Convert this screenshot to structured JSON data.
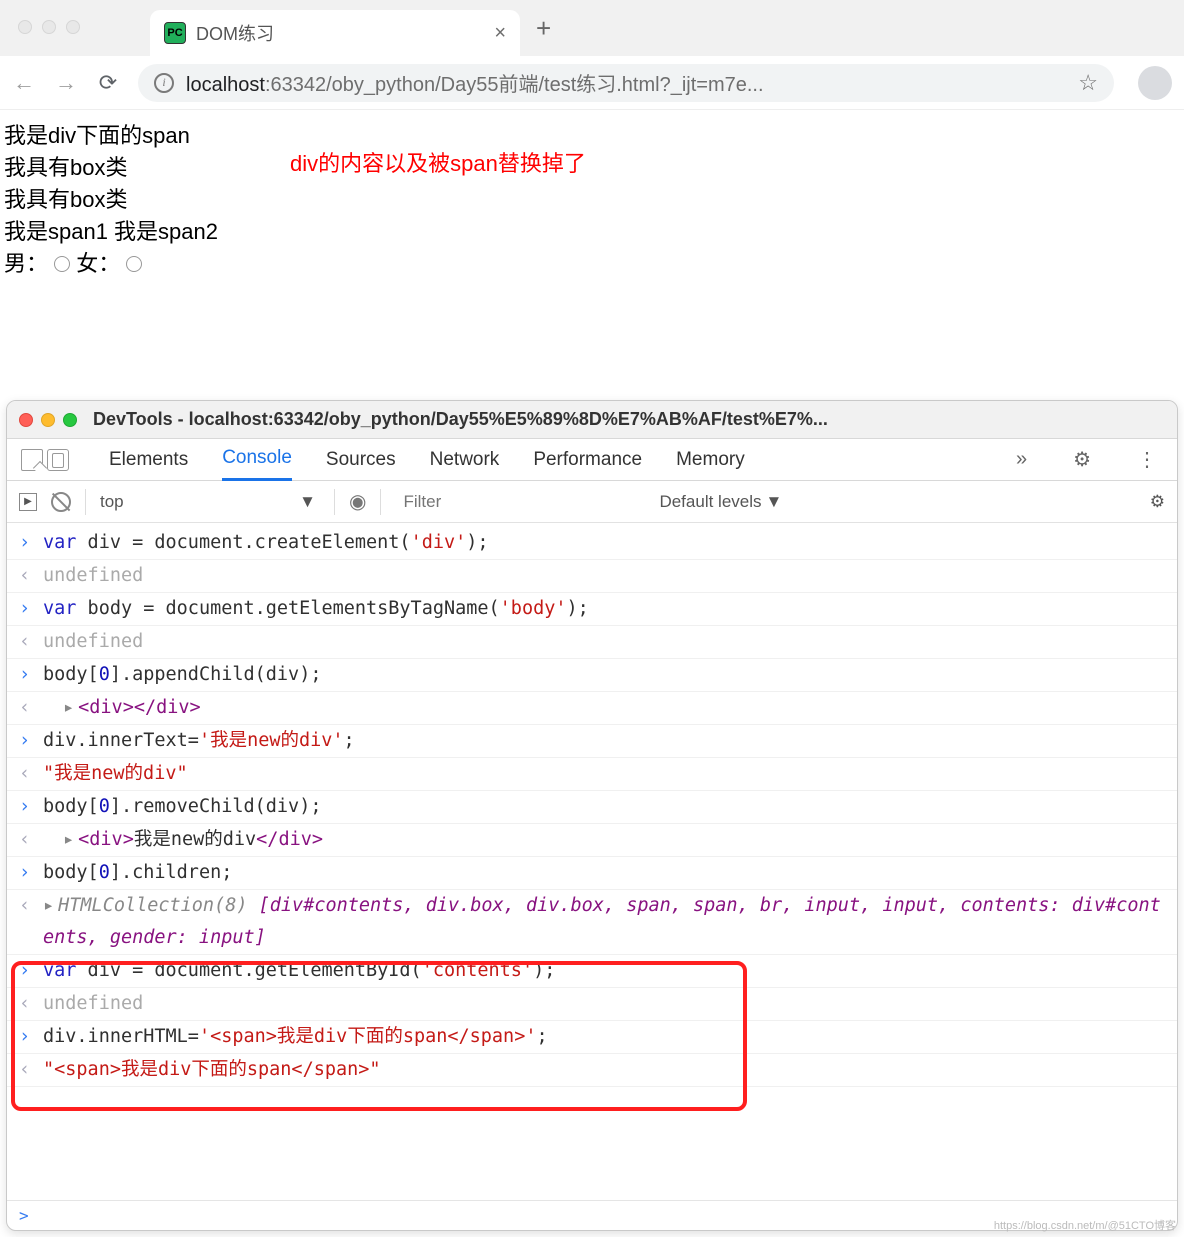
{
  "browser": {
    "tab_title": "DOM练习",
    "url_host": "localhost",
    "url_rest": ":63342/oby_python/Day55前端/test练习.html?_ijt=m7e..."
  },
  "page": {
    "line1": "我是div下面的span",
    "line2": "我具有box类",
    "line3": "我具有box类",
    "line4": "我是span1 我是span2",
    "gender_male": "男：",
    "gender_female": "女：",
    "annotation": "div的内容以及被span替换掉了"
  },
  "devtools": {
    "window_title": "DevTools - localhost:63342/oby_python/Day55%E5%89%8D%E7%AB%AF/test%E7%...",
    "tabs": [
      "Elements",
      "Console",
      "Sources",
      "Network",
      "Performance",
      "Memory"
    ],
    "active_tab": "Console",
    "context": "top",
    "filter_placeholder": "Filter",
    "levels": "Default levels",
    "console": {
      "r1_in": {
        "pre": "var",
        "mid": " div = document.createElement(",
        "str": "'div'",
        "post": ");"
      },
      "r1_out": "undefined",
      "r2_in": {
        "pre": "var",
        "mid": " body = document.getElementsByTagName(",
        "str": "'body'",
        "post": ");"
      },
      "r2_out": "undefined",
      "r3_in": {
        "pre": "body[",
        "num": "0",
        "mid": "].appendChild(div);"
      },
      "r3_out_open": "<div>",
      "r3_out_close": "</div>",
      "r4_in": {
        "pre": "div.innerText=",
        "str": "'我是new的div'",
        "post": ";"
      },
      "r4_out": "\"我是new的div\"",
      "r5_in": {
        "pre": "body[",
        "num": "0",
        "mid": "].removeChild(div);"
      },
      "r5_out_open": "<div>",
      "r5_out_text": "我是new的div",
      "r5_out_close": "</div>",
      "r6_in": {
        "pre": "body[",
        "num": "0",
        "mid": "].children;"
      },
      "r6_out_head": "HTMLCollection(8)",
      "r6_out_body": " [div#contents, div.box, div.box, span, span, br, input, input, contents: div#contents, gender: input]",
      "r7_in": {
        "pre": "var",
        "mid": " div = document.getElementById(",
        "str": "'contents'",
        "post": ");"
      },
      "r7_out": "undefined",
      "r8_in": {
        "pre": "div.innerHTML=",
        "str": "'<span>我是div下面的span</span>'",
        "post": ";"
      },
      "r8_out": "\"<span>我是div下面的span</span>\""
    },
    "prompt": ">"
  },
  "watermark": "https://blog.csdn.net/m/@51CTO博客"
}
